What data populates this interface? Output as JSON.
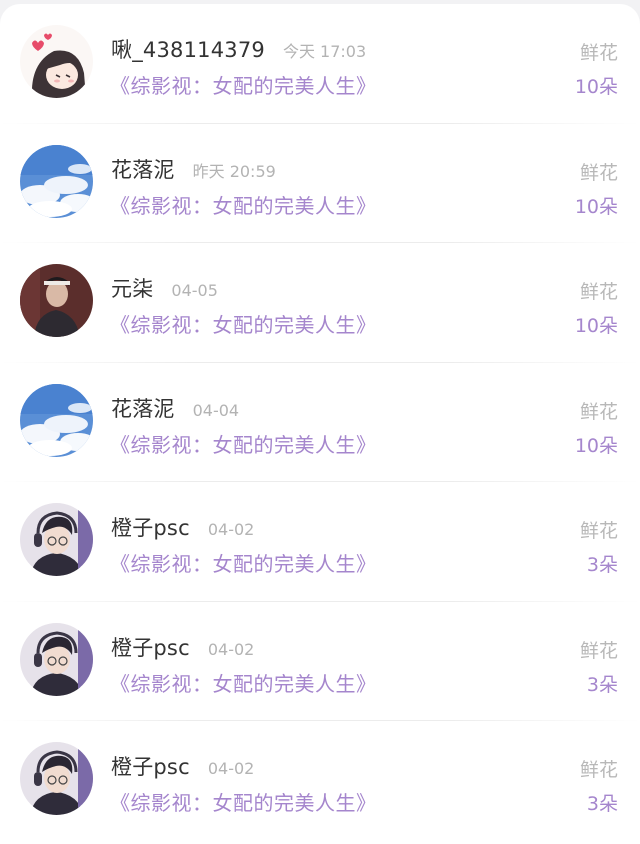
{
  "records": [
    {
      "name": "啾_438114379",
      "time": "今天 17:03",
      "book": "《综影视：女配的完美人生》",
      "gift": "鲜花",
      "count": "10朵",
      "avatar": "anime-girl-avatar"
    },
    {
      "name": "花落泥",
      "time": "昨天 20:59",
      "book": "《综影视：女配的完美人生》",
      "gift": "鲜花",
      "count": "10朵",
      "avatar": "blue-sky-avatar"
    },
    {
      "name": "元柒",
      "time": "04-05",
      "book": "《综影视：女配的完美人生》",
      "gift": "鲜花",
      "count": "10朵",
      "avatar": "man-portrait-avatar"
    },
    {
      "name": "花落泥",
      "time": "04-04",
      "book": "《综影视：女配的完美人生》",
      "gift": "鲜花",
      "count": "10朵",
      "avatar": "blue-sky-avatar"
    },
    {
      "name": "橙子psc",
      "time": "04-02",
      "book": "《综影视：女配的完美人生》",
      "gift": "鲜花",
      "count": "3朵",
      "avatar": "headphone-boy-avatar"
    },
    {
      "name": "橙子psc",
      "time": "04-02",
      "book": "《综影视：女配的完美人生》",
      "gift": "鲜花",
      "count": "3朵",
      "avatar": "headphone-boy-avatar"
    },
    {
      "name": "橙子psc",
      "time": "04-02",
      "book": "《综影视：女配的完美人生》",
      "gift": "鲜花",
      "count": "3朵",
      "avatar": "headphone-boy-avatar"
    }
  ],
  "colors": {
    "accent": "#a586cd",
    "name": "#333333",
    "muted": "#b3b3b3"
  }
}
